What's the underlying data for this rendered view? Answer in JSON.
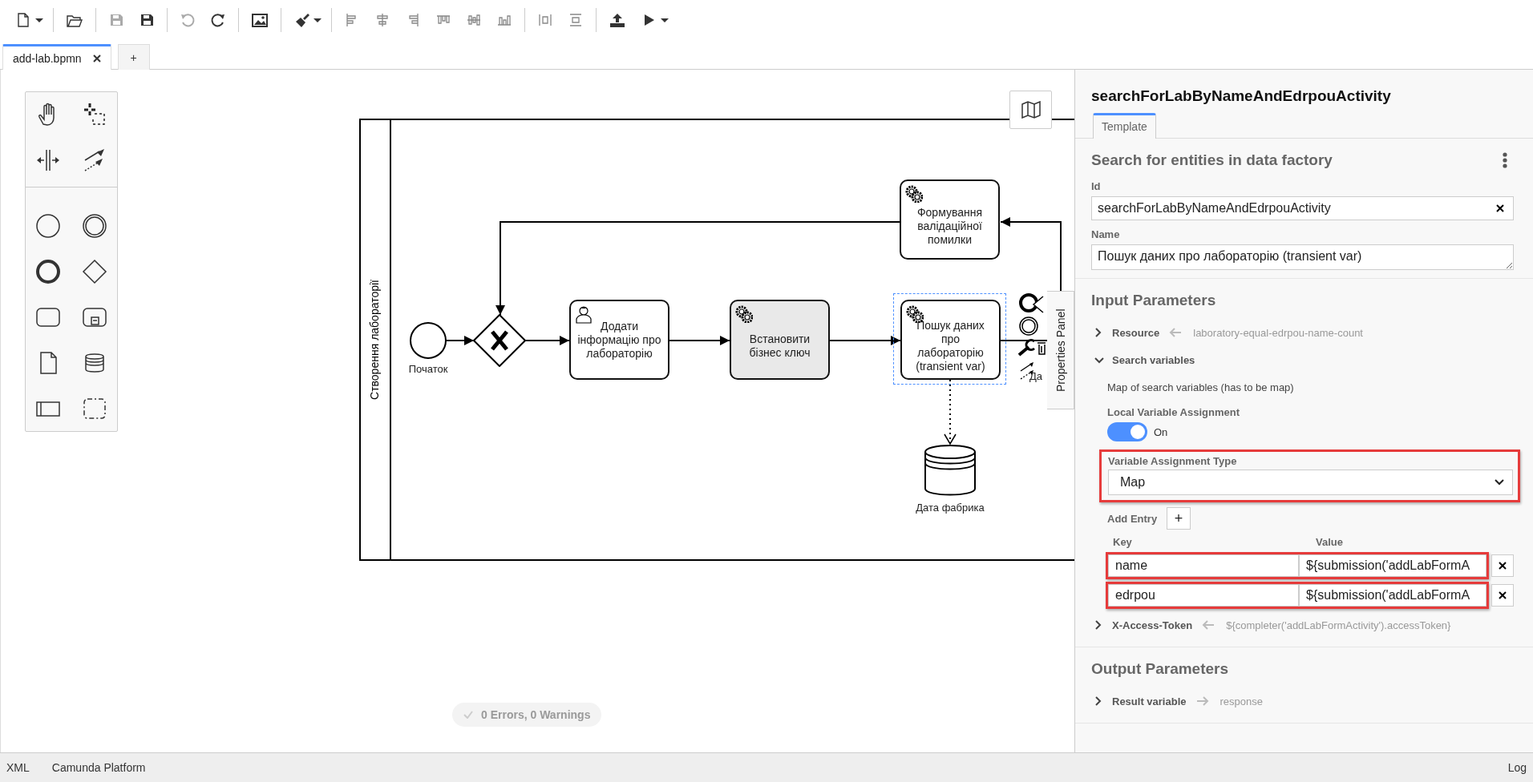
{
  "tabs": [
    {
      "label": "add-lab.bpmn",
      "selected": true
    }
  ],
  "add_tab": "+",
  "diagram": {
    "lane_label": "Створення лабораторії",
    "nodes": [
      {
        "kind": "service-task",
        "label": "Формування валідаційної помилки",
        "shaded": false,
        "selected": false
      },
      {
        "kind": "start-event",
        "label": "Початок"
      },
      {
        "kind": "exclusive-gateway"
      },
      {
        "kind": "user-task",
        "label": "Додати інформацію про лабораторію",
        "shaded": false,
        "selected": false
      },
      {
        "kind": "service-task",
        "label": "Встановити бізнес ключ",
        "shaded": true,
        "selected": false
      },
      {
        "kind": "service-task",
        "label": "Пошук даних про лабораторію (transient var)",
        "shaded": false,
        "selected": true
      },
      {
        "kind": "data-store",
        "label": "Дата фабрика"
      }
    ],
    "context_pad_label": "Да",
    "lint_status": "0 Errors, 0 Warnings",
    "panel_toggle": "Properties Panel"
  },
  "properties": {
    "title": "searchForLabByNameAndEdrpouActivity",
    "tabs": [
      {
        "label": "Template",
        "selected": true
      }
    ],
    "group_title": "Search for entities in data factory",
    "fields": [
      {
        "kind": "text",
        "label": "Id",
        "value": "searchForLabByNameAndEdrpouActivity"
      },
      {
        "kind": "textarea",
        "label": "Name",
        "value": "Пошук даних про лабораторію (transient var)"
      }
    ],
    "input_parameters": {
      "title": "Input Parameters",
      "items": [
        {
          "kind": "input-mapping",
          "label": "Resource",
          "value": "laboratory-equal-edrpou-name-count",
          "expanded": false
        },
        {
          "kind": "map",
          "label": "Search variables",
          "expanded": true,
          "description": "Map of search variables (has to be map)",
          "local_assignment": {
            "label": "Local Variable Assignment",
            "on": true,
            "state_label": "On"
          },
          "assignment_type": {
            "label": "Variable Assignment Type",
            "value": "Map",
            "highlighted": true
          },
          "add_entry_label": "Add Entry",
          "add_button": "+",
          "columns": [
            "Key",
            "Value"
          ],
          "entries": [
            {
              "key": "name",
              "value": "${submission('addLabFormA",
              "highlighted": true
            },
            {
              "key": "edrpou",
              "value": "${submission('addLabFormA",
              "highlighted": true
            }
          ]
        },
        {
          "kind": "input-mapping",
          "label": "X-Access-Token",
          "value": "${completer('addLabFormActivity').accessToken}",
          "expanded": false
        }
      ]
    },
    "output_parameters": {
      "title": "Output Parameters",
      "items": [
        {
          "kind": "output-mapping",
          "label": "Result variable",
          "value": "response",
          "expanded": false
        }
      ]
    }
  },
  "status_bar": {
    "left": [
      "XML",
      "Camunda Platform"
    ],
    "right": "Log"
  }
}
